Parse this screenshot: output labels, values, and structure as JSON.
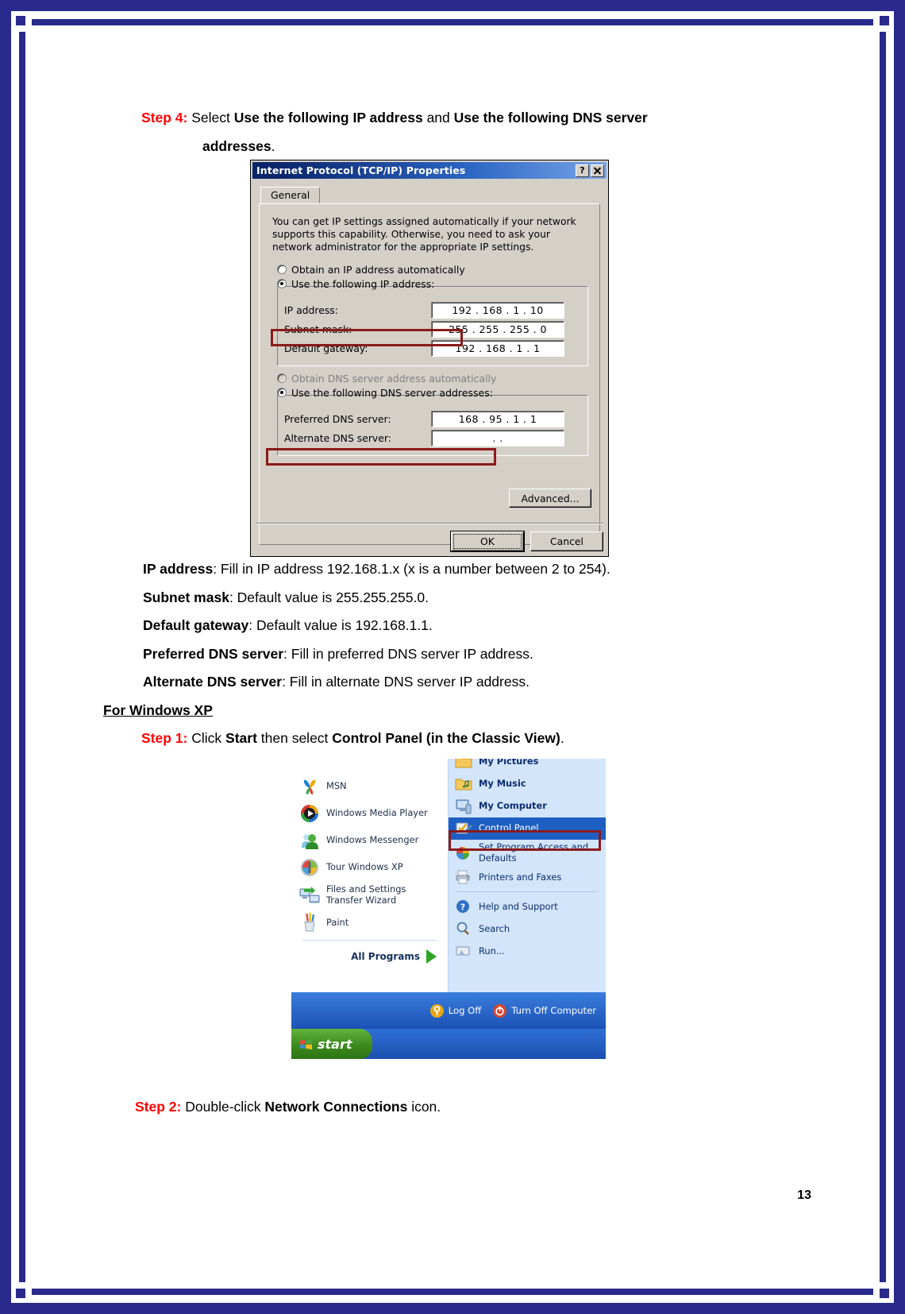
{
  "page": {
    "number": "13",
    "border_color": "#2a2a8c"
  },
  "step4": {
    "label": "Step 4:",
    "text_before": "Select",
    "bold1": "Use the following IP address",
    "mid": "and",
    "bold2": "Use the following DNS server",
    "cont_bold": "addresses",
    "cont_tail": "."
  },
  "dialog": {
    "title": "Internet Protocol (TCP/IP) Properties",
    "help_button": "?",
    "close_button": "close-x",
    "tab": "General",
    "description": "You can get IP settings assigned automatically if your network supports this capability. Otherwise, you need to ask your network administrator for the appropriate IP settings.",
    "radio_obtain_ip": "Obtain an IP address automatically",
    "radio_use_ip": "Use the following IP address:",
    "radio_obtain_dns": "Obtain DNS server address automatically",
    "radio_use_dns": "Use the following DNS server addresses:",
    "fields": [
      {
        "label": "IP address:",
        "value": "192 . 168 .  1  .  10"
      },
      {
        "label": "Subnet mask:",
        "value": "255 . 255 . 255 .  0"
      },
      {
        "label": "Default gateway:",
        "value": "192 . 168 .  1  .  1"
      }
    ],
    "dns_fields": [
      {
        "label": "Preferred DNS server:",
        "value": "168 .  95 .  1  .  1"
      },
      {
        "label": "Alternate DNS server:",
        "value": " .    .   "
      }
    ],
    "advanced_button": "Advanced...",
    "ok_button": "OK",
    "cancel_button": "Cancel",
    "highlight_color": "#8b1a1a"
  },
  "explanations": [
    {
      "term": "IP address",
      "rest": ": Fill in IP address 192.168.1.x (x is a number between 2 to 254)."
    },
    {
      "term": "Subnet mask",
      "rest": ": Default value is 255.255.255.0."
    },
    {
      "term": "Default gateway",
      "rest": ": Default value is 192.168.1.1."
    },
    {
      "term": "Preferred DNS server",
      "rest": ": Fill in preferred DNS server IP address."
    },
    {
      "term": "Alternate DNS server",
      "rest": ": Fill in alternate DNS server IP address."
    }
  ],
  "windows_xp_heading": "For Windows XP",
  "step1": {
    "label": "Step 1:",
    "text_before": "Click",
    "bold1": "Start",
    "mid": "then select",
    "bold2": "Control Panel (in the Classic View)",
    "tail": "."
  },
  "start_menu": {
    "left_items": [
      {
        "label": "MSN",
        "icon": "msn-butterfly-icon"
      },
      {
        "label": "Windows Media Player",
        "icon": "media-player-icon"
      },
      {
        "label": "Windows Messenger",
        "icon": "messenger-icon"
      },
      {
        "label": "Tour Windows XP",
        "icon": "tour-windows-icon"
      },
      {
        "label": "Files and Settings Transfer Wizard",
        "icon": "transfer-wizard-icon"
      },
      {
        "label": "Paint",
        "icon": "paint-icon"
      }
    ],
    "all_programs": "All Programs",
    "all_programs_arrow": "triangle-right-icon",
    "right_items": [
      {
        "label": "My Pictures",
        "icon": "folder-pictures-icon",
        "bold": true,
        "clipped": true
      },
      {
        "label": "My Music",
        "icon": "folder-music-icon",
        "bold": true
      },
      {
        "label": "My Computer",
        "icon": "my-computer-icon",
        "bold": true
      },
      {
        "label": "Control Panel",
        "icon": "control-panel-icon",
        "bold": false,
        "highlighted": true
      },
      {
        "label": "Set Program Access and Defaults",
        "icon": "set-program-access-icon",
        "bold": false
      },
      {
        "label": "Printers and Faxes",
        "icon": "printer-icon",
        "bold": false
      },
      {
        "label": "Help and Support",
        "icon": "help-question-icon",
        "bold": false
      },
      {
        "label": "Search",
        "icon": "search-magnifier-icon",
        "bold": false
      },
      {
        "label": "Run...",
        "icon": "run-icon",
        "bold": false
      }
    ],
    "log_off": "Log Off",
    "turn_off": "Turn Off Computer",
    "start_button": "start"
  },
  "step2": {
    "label": "Step 2:",
    "text_before": "Double-click",
    "bold1": "Network Connections",
    "tail": "icon."
  }
}
